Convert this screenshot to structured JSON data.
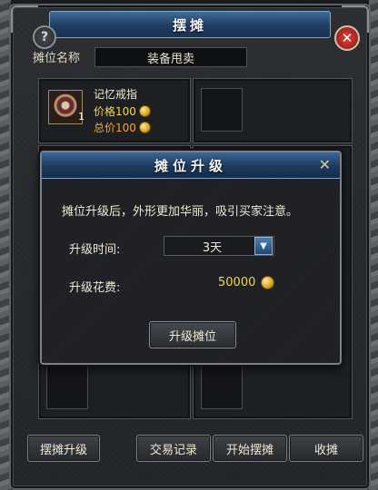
{
  "window": {
    "title": "摆摊",
    "help_glyph": "?",
    "close_glyph": "✕"
  },
  "stall": {
    "name_label": "摊位名称",
    "name_value": "装备甩卖"
  },
  "items": [
    {
      "name": "记忆戒指",
      "count": "1",
      "price_text": "价格100",
      "total_text": "总价100"
    }
  ],
  "buttons": {
    "stall_upgrade": "摆摊升级",
    "trade_log": "交易记录",
    "start_stall": "开始摆摊",
    "close_stall": "收摊"
  },
  "dialog": {
    "title": "摊位升级",
    "close_glyph": "✕",
    "message": "摊位升级后，外形更加华丽，吸引买家注意。",
    "time_label": "升级时间:",
    "time_value": "3天",
    "cost_label": "升级花费:",
    "cost_value": "50000",
    "confirm_label": "升级摊位"
  },
  "colors": {
    "title_blue": "#1f3d60",
    "gold": "#f2d65a",
    "total_orange": "#f2a634",
    "close_red": "#c0201a"
  },
  "icons": {
    "help": "question-icon",
    "close": "close-icon",
    "coin": "gold-coin-icon",
    "dropdown": "chevron-down-icon",
    "item": "ring-icon"
  }
}
